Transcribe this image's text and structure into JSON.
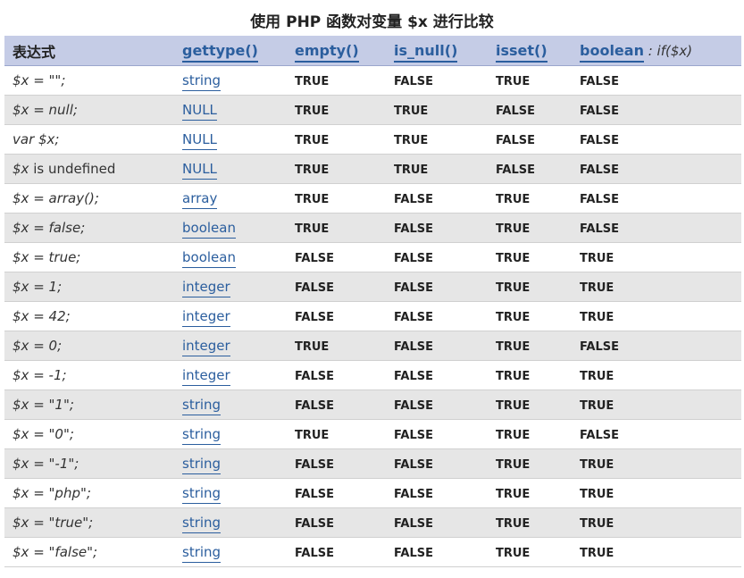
{
  "caption": "使用 PHP 函数对变量 $x 进行比较",
  "header": {
    "expr": "表达式",
    "gettype": "gettype()",
    "empty": "empty()",
    "is_null": "is_null()",
    "isset": "isset()",
    "boolean": "boolean",
    "boolean_suffix": " : if($x)"
  },
  "rows": [
    {
      "expr": "$x = \"\";",
      "type": "string",
      "empty": "TRUE",
      "is_null": "FALSE",
      "isset": "TRUE",
      "boolean": "FALSE"
    },
    {
      "expr": "$x = null;",
      "type": "NULL",
      "empty": "TRUE",
      "is_null": "TRUE",
      "isset": "FALSE",
      "boolean": "FALSE"
    },
    {
      "expr": "var $x;",
      "type": "NULL",
      "empty": "TRUE",
      "is_null": "TRUE",
      "isset": "FALSE",
      "boolean": "FALSE"
    },
    {
      "expr": "$x is undefined",
      "type": "NULL",
      "empty": "TRUE",
      "is_null": "TRUE",
      "isset": "FALSE",
      "boolean": "FALSE"
    },
    {
      "expr": "$x = array();",
      "type": "array",
      "empty": "TRUE",
      "is_null": "FALSE",
      "isset": "TRUE",
      "boolean": "FALSE"
    },
    {
      "expr": "$x = false;",
      "type": "boolean",
      "empty": "TRUE",
      "is_null": "FALSE",
      "isset": "TRUE",
      "boolean": "FALSE"
    },
    {
      "expr": "$x = true;",
      "type": "boolean",
      "empty": "FALSE",
      "is_null": "FALSE",
      "isset": "TRUE",
      "boolean": "TRUE"
    },
    {
      "expr": "$x = 1;",
      "type": "integer",
      "empty": "FALSE",
      "is_null": "FALSE",
      "isset": "TRUE",
      "boolean": "TRUE"
    },
    {
      "expr": "$x = 42;",
      "type": "integer",
      "empty": "FALSE",
      "is_null": "FALSE",
      "isset": "TRUE",
      "boolean": "TRUE"
    },
    {
      "expr": "$x = 0;",
      "type": "integer",
      "empty": "TRUE",
      "is_null": "FALSE",
      "isset": "TRUE",
      "boolean": "FALSE"
    },
    {
      "expr": "$x = -1;",
      "type": "integer",
      "empty": "FALSE",
      "is_null": "FALSE",
      "isset": "TRUE",
      "boolean": "TRUE"
    },
    {
      "expr": "$x = \"1\";",
      "type": "string",
      "empty": "FALSE",
      "is_null": "FALSE",
      "isset": "TRUE",
      "boolean": "TRUE"
    },
    {
      "expr": "$x = \"0\";",
      "type": "string",
      "empty": "TRUE",
      "is_null": "FALSE",
      "isset": "TRUE",
      "boolean": "FALSE"
    },
    {
      "expr": "$x = \"-1\";",
      "type": "string",
      "empty": "FALSE",
      "is_null": "FALSE",
      "isset": "TRUE",
      "boolean": "TRUE"
    },
    {
      "expr": "$x = \"php\";",
      "type": "string",
      "empty": "FALSE",
      "is_null": "FALSE",
      "isset": "TRUE",
      "boolean": "TRUE"
    },
    {
      "expr": "$x = \"true\";",
      "type": "string",
      "empty": "FALSE",
      "is_null": "FALSE",
      "isset": "TRUE",
      "boolean": "TRUE"
    },
    {
      "expr": "$x = \"false\";",
      "type": "string",
      "empty": "FALSE",
      "is_null": "FALSE",
      "isset": "TRUE",
      "boolean": "TRUE"
    }
  ]
}
